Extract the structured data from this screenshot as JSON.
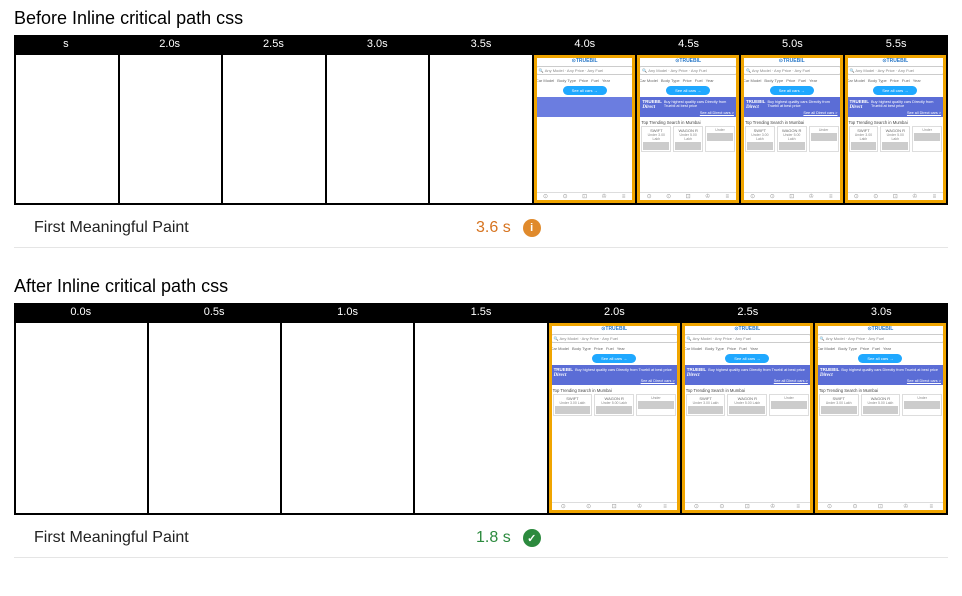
{
  "before": {
    "title": "Before Inline critical path css",
    "timestamps": [
      "s",
      "2.0s",
      "2.5s",
      "3.0s",
      "3.5s",
      "4.0s",
      "4.5s",
      "5.0s",
      "5.5s"
    ],
    "frames": [
      {
        "state": "blank"
      },
      {
        "state": "blank"
      },
      {
        "state": "blank"
      },
      {
        "state": "blank"
      },
      {
        "state": "blank"
      },
      {
        "state": "partial"
      },
      {
        "state": "full"
      },
      {
        "state": "full"
      },
      {
        "state": "full"
      }
    ],
    "metric": {
      "label": "First Meaningful Paint",
      "value": "3.6 s",
      "status": "warn"
    }
  },
  "after": {
    "title": "After Inline critical path css",
    "timestamps": [
      "0.0s",
      "0.5s",
      "1.0s",
      "1.5s",
      "2.0s",
      "2.5s",
      "3.0s"
    ],
    "frames": [
      {
        "state": "blank"
      },
      {
        "state": "blank"
      },
      {
        "state": "blank"
      },
      {
        "state": "blank"
      },
      {
        "state": "full"
      },
      {
        "state": "full"
      },
      {
        "state": "full"
      }
    ],
    "metric": {
      "label": "First Meaningful Paint",
      "value": "1.8 s",
      "status": "ok"
    }
  },
  "mock": {
    "logo": "⊙TRUEBIL",
    "search": "Any Model · Any Price · Any Fuel",
    "search_icon": "🔍",
    "tabs": [
      "Car Model",
      "Body Type",
      "Price",
      "Fuel",
      "Year"
    ],
    "cta": "See all cars →",
    "banner_brand": "TRUEBIL",
    "banner_brand_sub": "Direct",
    "banner_copy": "Buy highest quality cars Directly from Truebil at best price",
    "banner_link": "See all Direct cars >",
    "trending": "Top Trending Search in Mumbai",
    "cards": [
      {
        "title": "SWIFT",
        "price": "Under 3.00 Lakh"
      },
      {
        "title": "WAGON R",
        "price": "Under 5.00 Lakh"
      },
      {
        "title": "",
        "price": "Under"
      }
    ],
    "nav": [
      {
        "icon": "⊙",
        "label": "BROWSE"
      },
      {
        "icon": "⊙",
        "label": "TEST DRIVE"
      },
      {
        "icon": "⊡",
        "label": "SHORTLIST"
      },
      {
        "icon": "♔",
        "label": "PREMIUM"
      },
      {
        "icon": "≡",
        "label": ""
      }
    ]
  },
  "icons": {
    "warn": "i",
    "ok": "✓"
  }
}
